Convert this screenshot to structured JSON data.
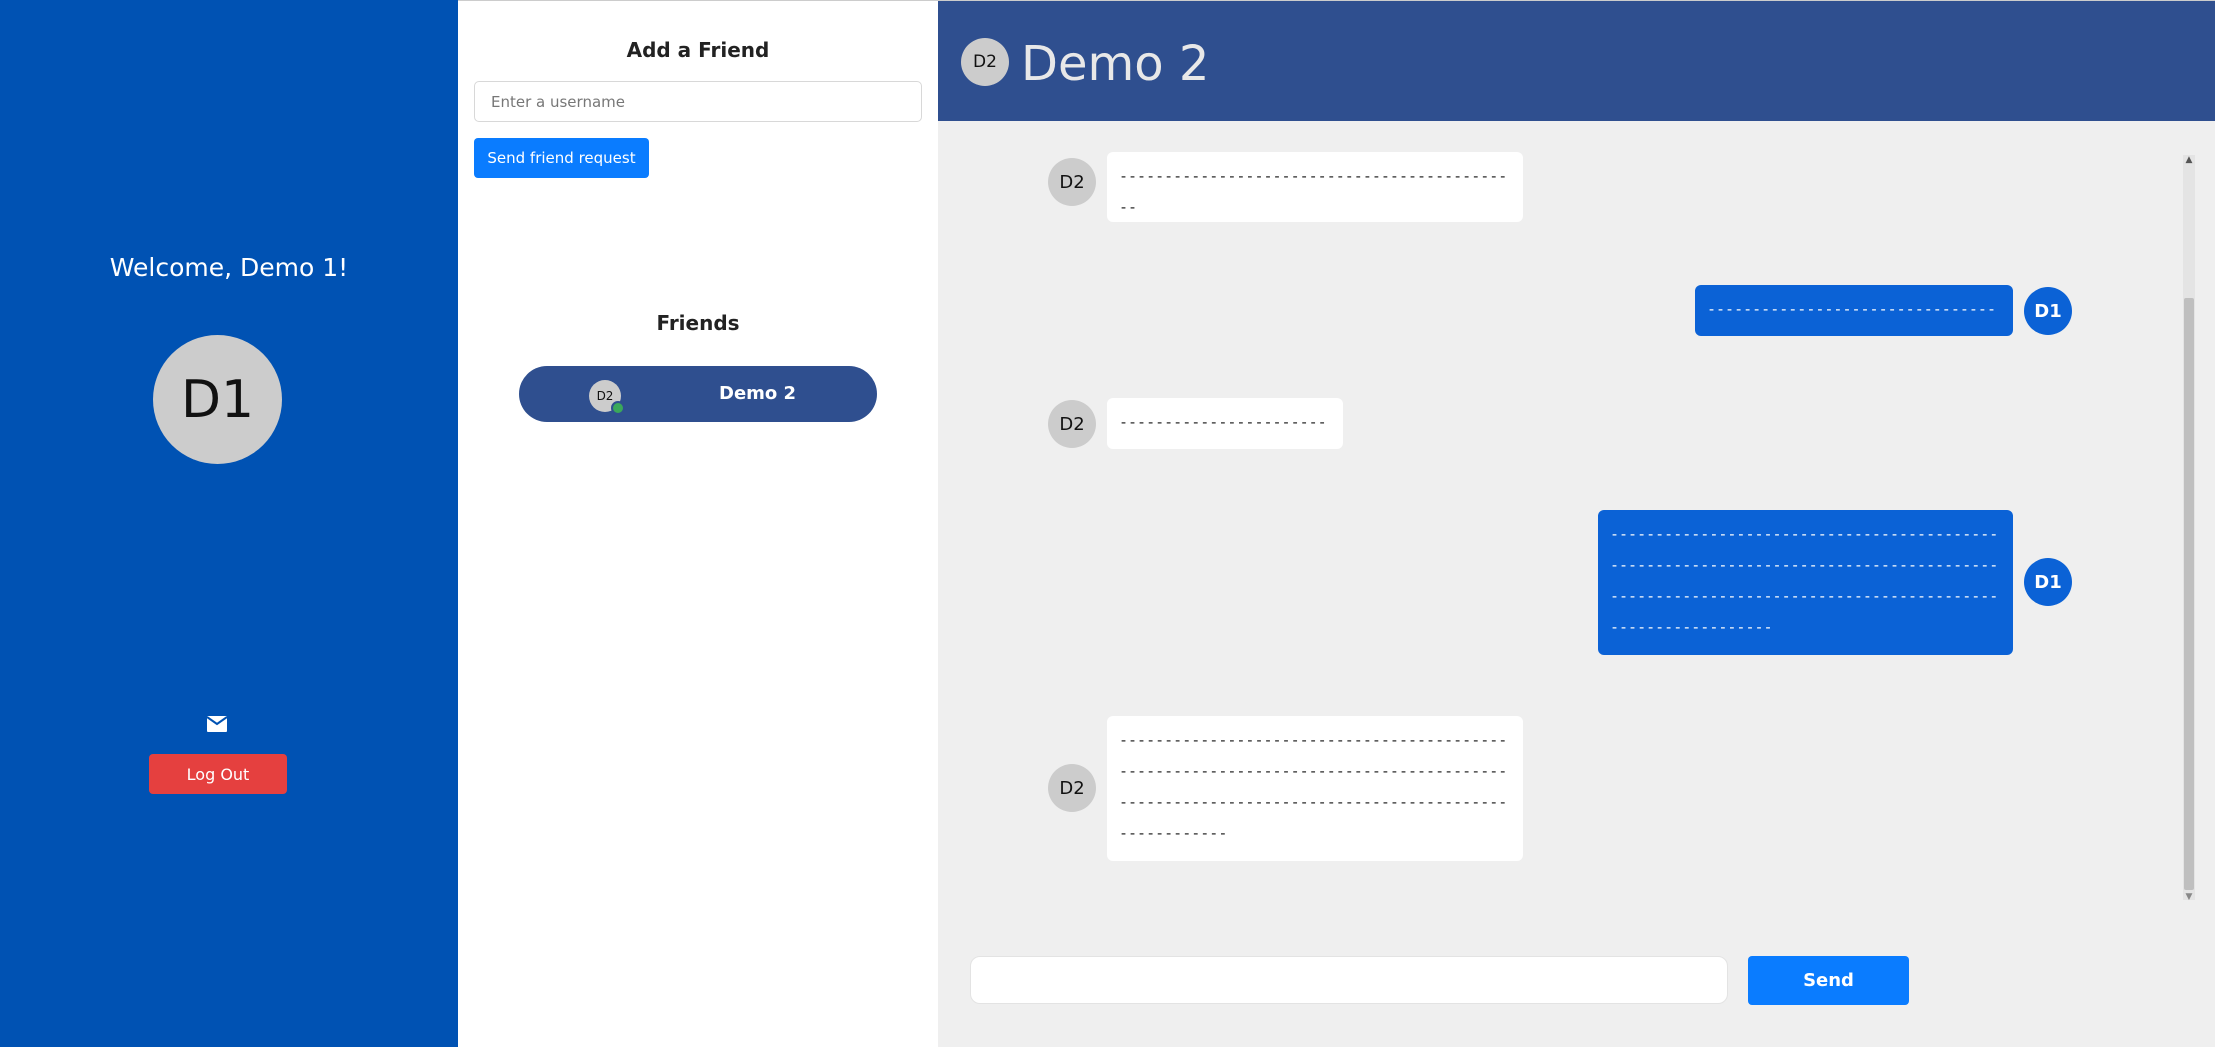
{
  "profile": {
    "welcome_text": "Welcome, Demo 1!",
    "avatar_initials": "D1",
    "logout_label": "Log Out",
    "mail_icon": "envelope-icon"
  },
  "add_friend": {
    "title": "Add a Friend",
    "username_placeholder": "Enter a username",
    "username_value": "",
    "send_request_label": "Send friend request"
  },
  "friends": {
    "title": "Friends",
    "items": [
      {
        "initials": "D2",
        "name": "Demo 2",
        "online": true
      }
    ]
  },
  "chat": {
    "header_initials": "D2",
    "header_name": "Demo 2",
    "messages": [
      {
        "from": "D2",
        "side": "them",
        "text": "---------------------------------------------"
      },
      {
        "from": "D1",
        "side": "me",
        "text": "-----------------------------------"
      },
      {
        "from": "D2",
        "side": "them",
        "text": "-------------------------"
      },
      {
        "from": "D1",
        "side": "me",
        "text": "---------------------------------------------------------------------------------------------------------------------------------------------------"
      },
      {
        "from": "D2",
        "side": "them",
        "text": "---------------------------------------------------------------------------------------------------------------------------------------------"
      }
    ],
    "input_value": "",
    "send_label": "Send"
  },
  "colors": {
    "profile_bg": "#0052b3",
    "chat_header_bg": "#2f4f8f",
    "my_bubble": "#0b62d6",
    "their_bubble": "#ffffff",
    "primary_button": "#0a7cff",
    "logout_button": "#e5403f",
    "online_indicator": "#3aa85a"
  }
}
